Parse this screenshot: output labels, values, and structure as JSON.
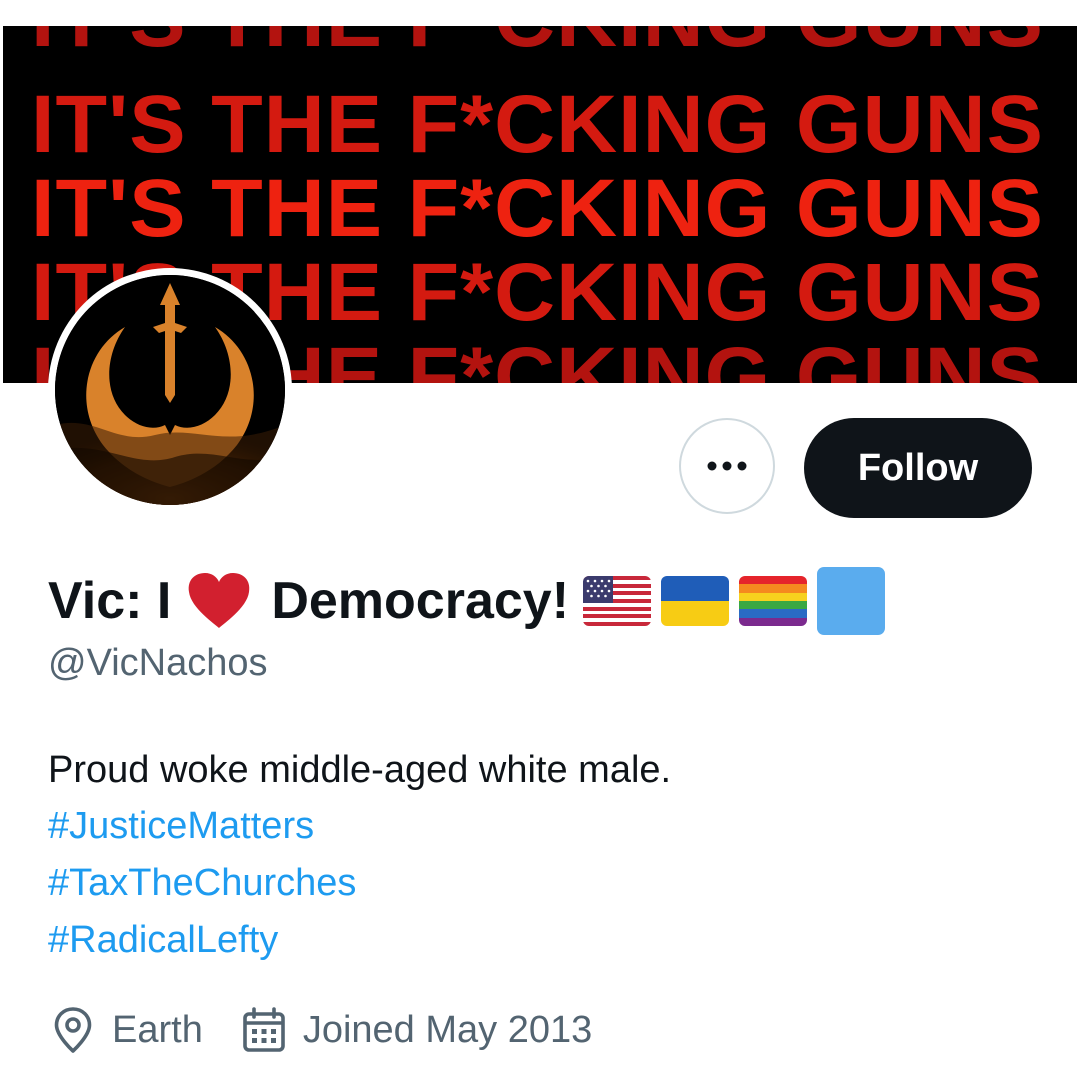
{
  "banner": {
    "text_lines": [
      "IT'S THE F*CKING GUNS",
      "IT'S THE F*CKING GUNS",
      "IT'S THE F*CKING GUNS",
      "IT'S THE F*CKING GUNS",
      "IT'S THE F*CKING GUNS"
    ],
    "background_color": "#000000",
    "text_color": "#e8200f"
  },
  "avatar": {
    "icon": "rebel-alliance-icon",
    "color": "#d9822b"
  },
  "actions": {
    "more_icon": "more-options-icon",
    "follow_label": "Follow"
  },
  "profile": {
    "name_part1": "Vic: I",
    "name_heart_icon": "red-heart-icon",
    "name_part2": "Democracy!",
    "name_emojis": [
      "us-flag-icon",
      "ukraine-flag-icon",
      "rainbow-flag-icon",
      "blue-square-icon"
    ],
    "handle": "@VicNachos",
    "bio": "Proud woke middle-aged white male.",
    "hashtags": [
      "#JusticeMatters",
      "#TaxTheChurches",
      "#RadicalLefty"
    ],
    "location_icon": "location-pin-icon",
    "location": "Earth",
    "calendar_icon": "calendar-icon",
    "joined": "Joined May 2013"
  },
  "colors": {
    "text_primary": "#0f1419",
    "text_secondary": "#536471",
    "link": "#1d9bf0",
    "heart": "#d2202f"
  }
}
